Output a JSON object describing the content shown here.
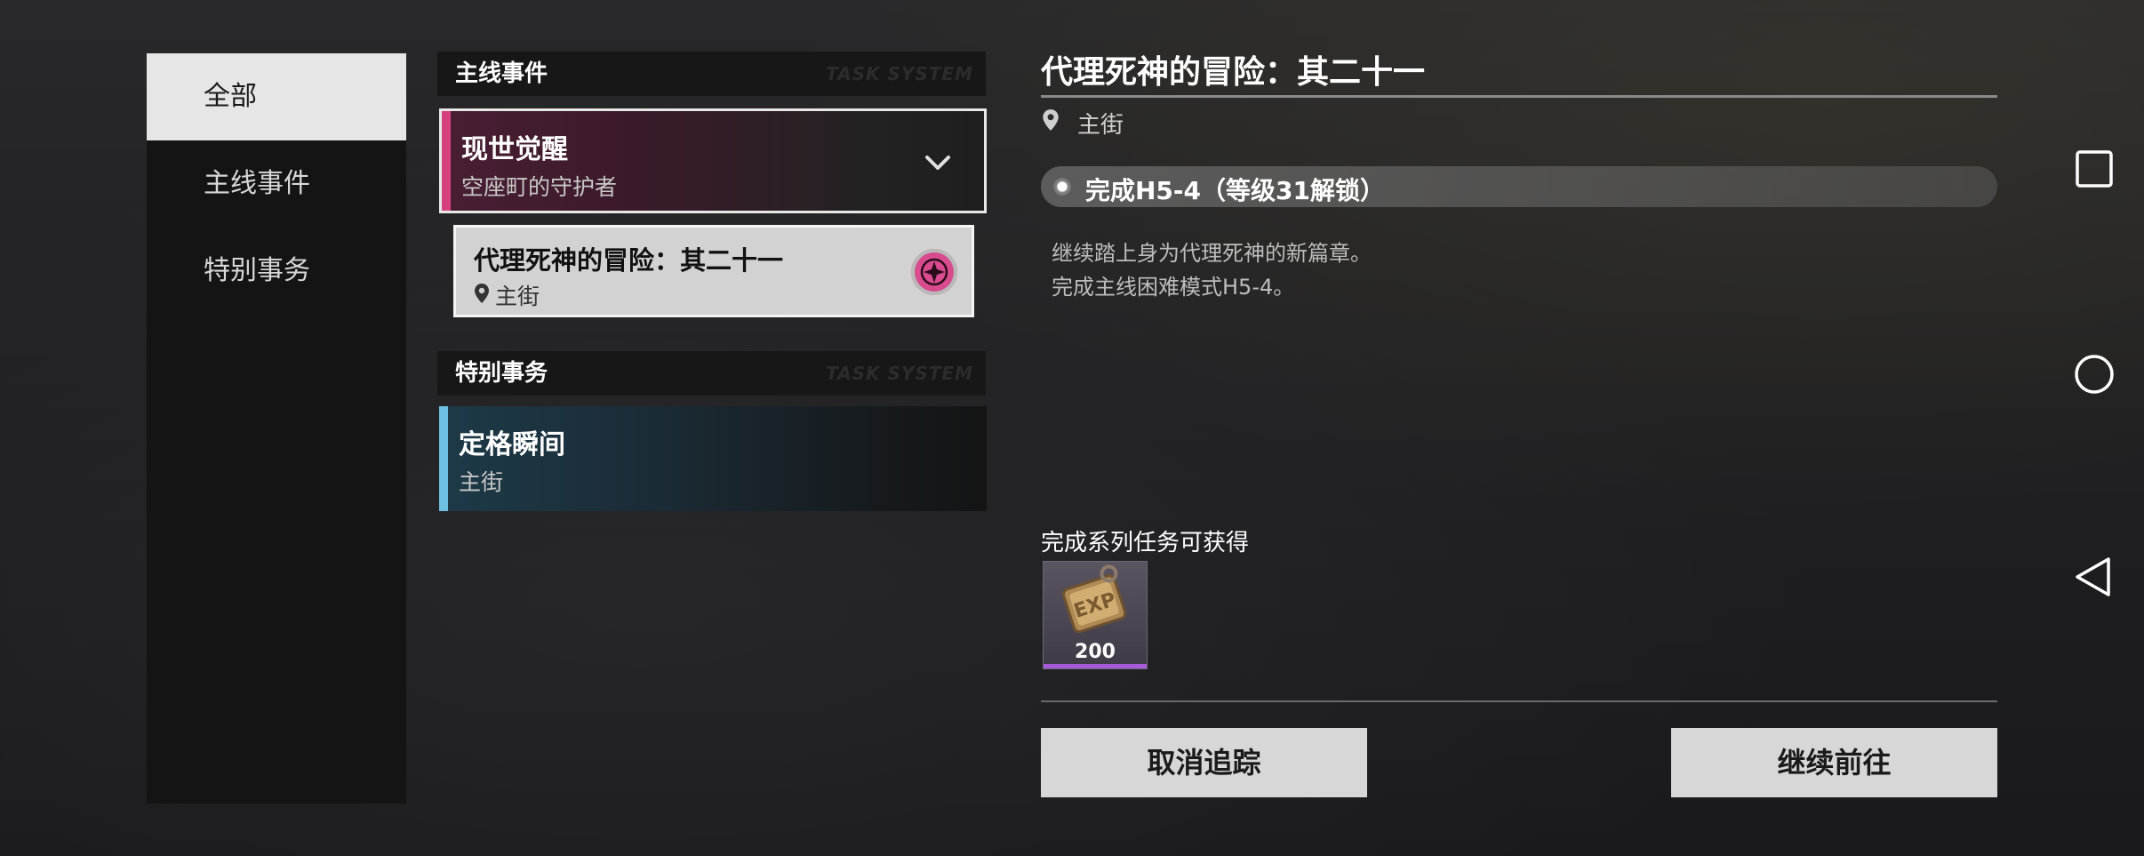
{
  "sidebar": {
    "items": [
      {
        "label": "全部",
        "active": true
      },
      {
        "label": "主线事件",
        "active": false
      },
      {
        "label": "特别事务",
        "active": false
      }
    ]
  },
  "task_list": {
    "main_section": {
      "header": "主线事件",
      "watermark": "TASK SYSTEM"
    },
    "main_card": {
      "title": "现世觉醒",
      "subtitle": "空座町的守护者",
      "accent": "#d6407e"
    },
    "sub_card": {
      "title": "代理死神的冒险：其二十一",
      "location": "主街"
    },
    "special_section": {
      "header": "特别事务",
      "watermark": "TASK SYSTEM"
    },
    "special_card": {
      "title": "定格瞬间",
      "subtitle": "主街",
      "accent": "#6fc1e3"
    }
  },
  "detail": {
    "title": "代理死神的冒险：其二十一",
    "location": "主街",
    "requirement": "完成H5-4（等级31解锁）",
    "description": [
      "继续踏上身为代理死神的新篇章。",
      "完成主线困难模式H5-4。"
    ],
    "reward_label": "完成系列任务可获得",
    "reward": {
      "icon": "exp-badge-icon",
      "count": "200"
    },
    "cancel_button": "取消追踪",
    "continue_button": "继续前往"
  },
  "system_nav": {
    "icons": [
      "recent-apps-icon",
      "home-icon",
      "back-icon"
    ]
  }
}
